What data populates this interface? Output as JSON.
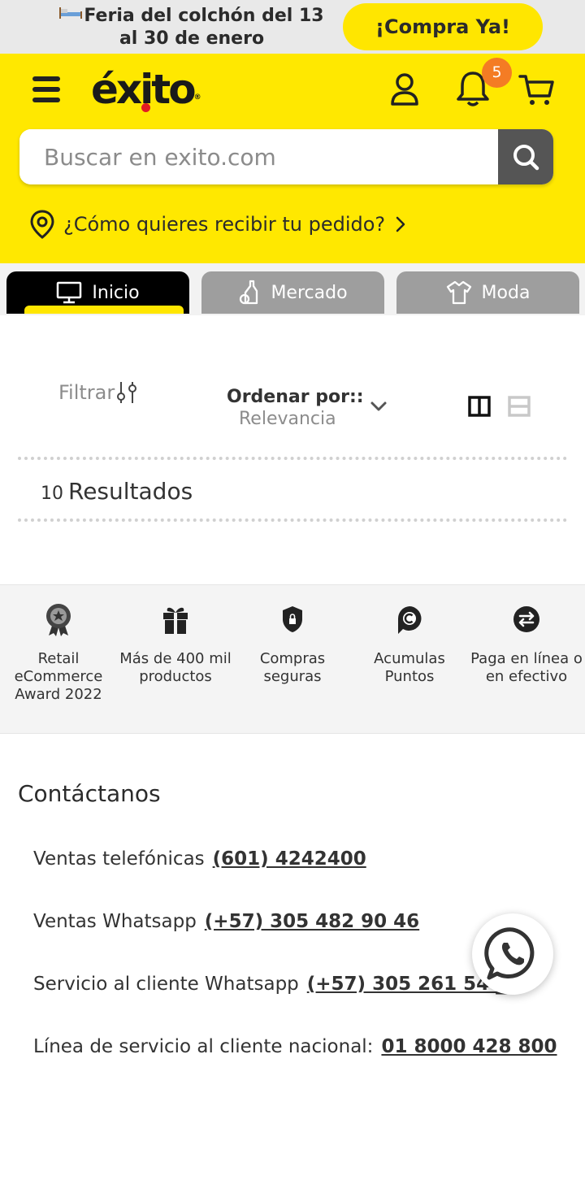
{
  "promo": {
    "text": "Feria del colchón del 13 al 30 de enero",
    "button": "¡Compra Ya!"
  },
  "header": {
    "logo": "éxito",
    "notifications_count": "5",
    "search_placeholder": "Buscar en exito.com",
    "delivery_prompt": "¿Cómo quieres recibir tu pedido?"
  },
  "tabs": [
    {
      "label": "Inicio",
      "icon": "monitor-icon",
      "active": true
    },
    {
      "label": "Mercado",
      "icon": "bottle-icon",
      "active": false
    },
    {
      "label": "Moda",
      "icon": "shirt-icon",
      "active": false
    }
  ],
  "filters": {
    "filter_label": "Filtrar",
    "sort_label": "Ordenar por::",
    "sort_value": "Relevancia"
  },
  "results": {
    "count": "10",
    "label": "Resultados"
  },
  "benefits": [
    {
      "label": "Retail eCommerce Award 2022",
      "icon": "award-icon"
    },
    {
      "label": "Más de 400 mil productos",
      "icon": "gift-icon"
    },
    {
      "label": "Compras seguras",
      "icon": "shield-lock-icon"
    },
    {
      "label": "Acumulas Puntos",
      "icon": "points-icon"
    },
    {
      "label": "Paga en línea o en efectivo",
      "icon": "exchange-icon"
    }
  ],
  "contact": {
    "title": "Contáctanos",
    "rows": [
      {
        "label": "Ventas telefónicas",
        "value": "(601) 4242400"
      },
      {
        "label": "Ventas Whatsapp",
        "value": "(+57) 305 482 90 46"
      },
      {
        "label": "Servicio al cliente Whatsapp",
        "value": "(+57) 305 261 54 __"
      },
      {
        "label": "Línea de servicio al cliente nacional:",
        "value": "01 8000 428 800"
      }
    ]
  },
  "colors": {
    "brand_yellow": "#ffe800",
    "badge_orange": "#f47c24",
    "active_tab": "#000000",
    "inactive_tab": "#9e9e9e"
  }
}
